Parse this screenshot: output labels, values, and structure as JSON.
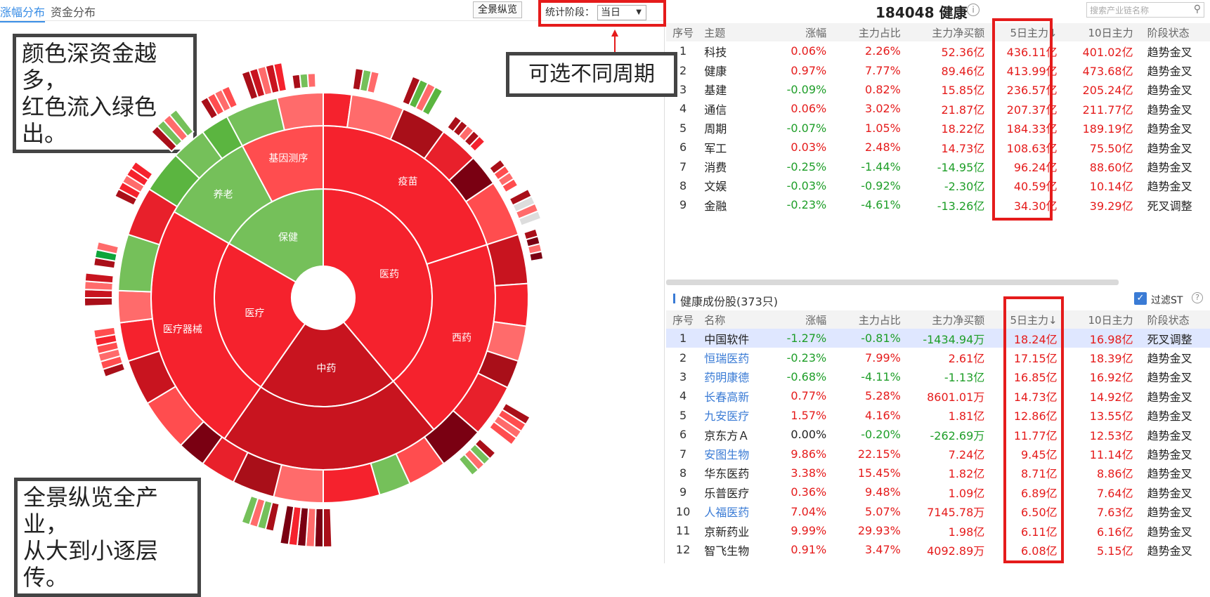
{
  "tabs": [
    "涨幅分布",
    "资金分布"
  ],
  "panorama_button": "全景纵览",
  "stat": {
    "label": "统计阶段：",
    "value": "当日"
  },
  "callouts": {
    "color": [
      "颜色深资金越多，",
      "红色流入绿色出。"
    ],
    "period": "可选不同周期",
    "overview": [
      "全景纵览全产业，",
      "从大到小逐层传。"
    ]
  },
  "sunburst": {
    "center_labels": [
      "医药",
      "医疗",
      "中药",
      "保健"
    ],
    "ring2_labels": [
      "疫苗",
      "西药",
      "医疗器械",
      "养老",
      "基因测序"
    ]
  },
  "header": {
    "title": "184048 健康",
    "search_placeholder": "搜索产业链名称"
  },
  "top_table": {
    "columns": [
      "序号",
      "主题",
      "涨幅",
      "主力占比",
      "主力净买额",
      "5日主力↓",
      "10日主力",
      "阶段状态"
    ],
    "rows": [
      [
        "1",
        "科技",
        "0.06%",
        "2.26%",
        "52.36亿",
        "436.11亿",
        "401.02亿",
        "趋势金叉"
      ],
      [
        "2",
        "健康",
        "0.97%",
        "7.77%",
        "89.46亿",
        "413.99亿",
        "473.68亿",
        "趋势金叉"
      ],
      [
        "3",
        "基建",
        "-0.09%",
        "0.82%",
        "15.85亿",
        "236.57亿",
        "205.24亿",
        "趋势金叉"
      ],
      [
        "4",
        "通信",
        "0.06%",
        "3.02%",
        "21.87亿",
        "207.37亿",
        "211.77亿",
        "趋势金叉"
      ],
      [
        "5",
        "周期",
        "-0.07%",
        "1.05%",
        "18.22亿",
        "184.33亿",
        "189.19亿",
        "趋势金叉"
      ],
      [
        "6",
        "军工",
        "0.03%",
        "2.48%",
        "14.73亿",
        "108.63亿",
        "75.50亿",
        "趋势金叉"
      ],
      [
        "7",
        "消费",
        "-0.25%",
        "-1.44%",
        "-14.95亿",
        "96.24亿",
        "88.60亿",
        "趋势金叉"
      ],
      [
        "8",
        "文娱",
        "-0.03%",
        "-0.92%",
        "-2.30亿",
        "40.59亿",
        "10.14亿",
        "趋势金叉"
      ],
      [
        "9",
        "金融",
        "-0.23%",
        "-4.61%",
        "-13.26亿",
        "34.30亿",
        "39.29亿",
        "死叉调整"
      ]
    ]
  },
  "stocks": {
    "title": "健康成份股(373只)",
    "filter_label": "过滤ST",
    "columns": [
      "序号",
      "名称",
      "涨幅",
      "主力占比",
      "主力净买额",
      "5日主力↓",
      "10日主力",
      "阶段状态"
    ],
    "rows": [
      [
        "1",
        "中国软件",
        "-1.27%",
        "-0.81%",
        "-1434.94万",
        "18.24亿",
        "16.98亿",
        "死叉调整"
      ],
      [
        "2",
        "恒瑞医药",
        "-0.23%",
        "7.99%",
        "2.61亿",
        "17.15亿",
        "18.39亿",
        "趋势金叉"
      ],
      [
        "3",
        "药明康德",
        "-0.68%",
        "-4.11%",
        "-1.13亿",
        "16.85亿",
        "16.92亿",
        "趋势金叉"
      ],
      [
        "4",
        "长春高新",
        "0.77%",
        "5.28%",
        "8601.01万",
        "14.73亿",
        "14.92亿",
        "趋势金叉"
      ],
      [
        "5",
        "九安医疗",
        "1.57%",
        "4.16%",
        "1.81亿",
        "12.86亿",
        "13.55亿",
        "趋势金叉"
      ],
      [
        "6",
        "京东方Ａ",
        "0.00%",
        "-0.20%",
        "-262.69万",
        "11.77亿",
        "12.53亿",
        "趋势金叉"
      ],
      [
        "7",
        "安图生物",
        "9.86%",
        "22.15%",
        "7.24亿",
        "9.45亿",
        "11.14亿",
        "趋势金叉"
      ],
      [
        "8",
        "华东医药",
        "3.38%",
        "15.45%",
        "1.82亿",
        "8.71亿",
        "8.86亿",
        "趋势金叉"
      ],
      [
        "9",
        "乐普医疗",
        "0.36%",
        "9.48%",
        "1.09亿",
        "6.89亿",
        "7.64亿",
        "趋势金叉"
      ],
      [
        "10",
        "人福医药",
        "7.04%",
        "5.07%",
        "7145.78万",
        "6.50亿",
        "7.63亿",
        "趋势金叉"
      ],
      [
        "11",
        "京新药业",
        "9.99%",
        "29.93%",
        "1.98亿",
        "6.11亿",
        "6.16亿",
        "趋势金叉"
      ],
      [
        "12",
        "智飞生物",
        "0.91%",
        "3.47%",
        "4092.89万",
        "6.08亿",
        "5.15亿",
        "趋势金叉"
      ]
    ]
  }
}
